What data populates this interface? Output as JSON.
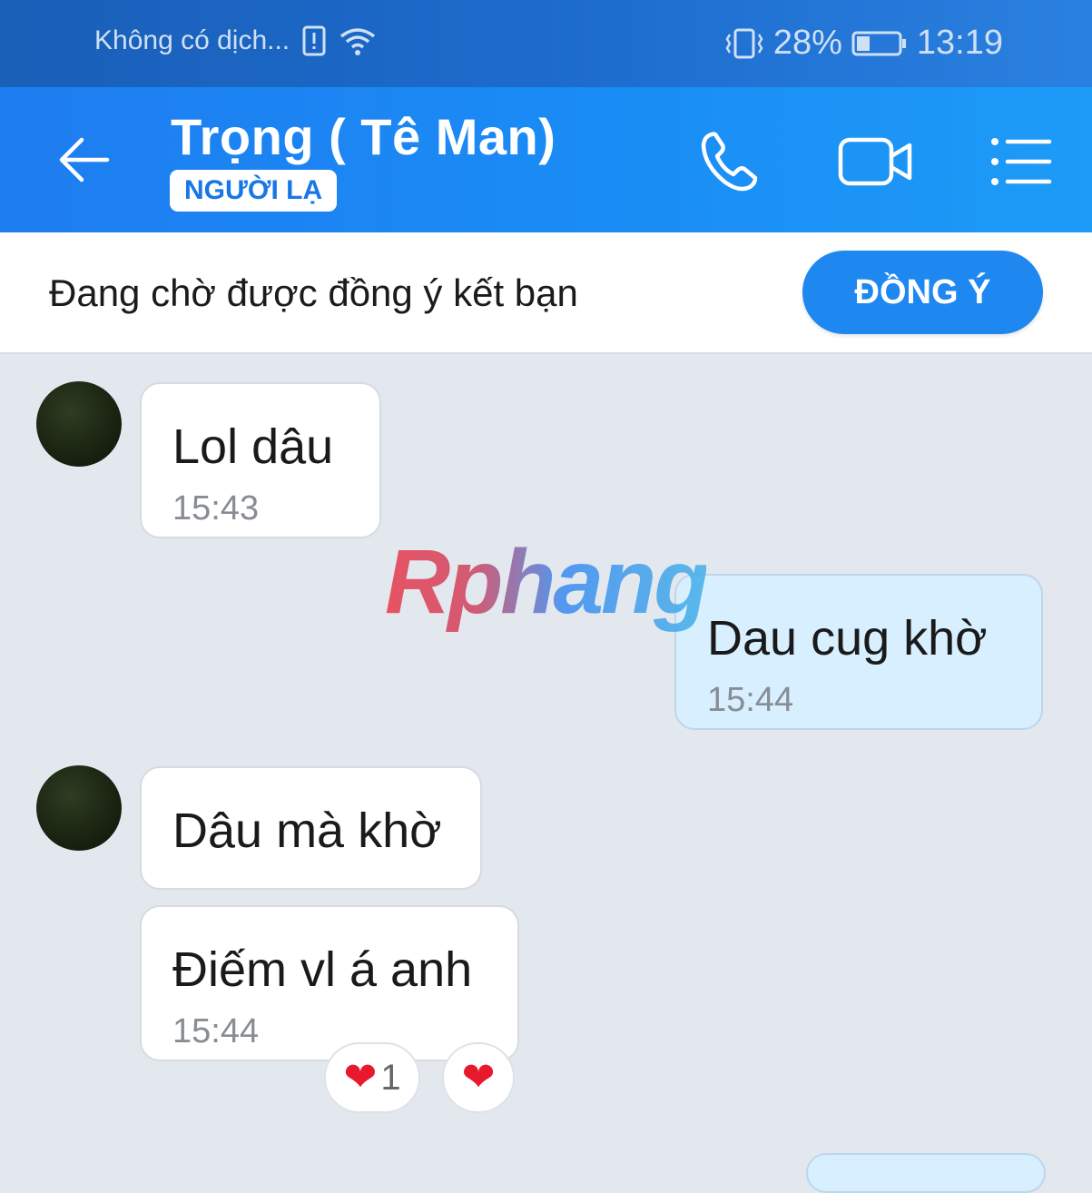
{
  "status_bar": {
    "network_text": "Không có dịch...",
    "battery_percent": "28%",
    "time": "13:19"
  },
  "header": {
    "title": "Trọng ( Tê Man)",
    "badge": "NGƯỜI LẠ"
  },
  "friend_request": {
    "text": "Đang chờ được đồng ý kết bạn",
    "button_label": "ĐỒNG Ý"
  },
  "watermark": "Rphang",
  "messages": [
    {
      "sender": "other",
      "text": "Lol dâu",
      "time": "15:43"
    },
    {
      "sender": "me",
      "text": "Dau cug khờ",
      "time": "15:44"
    },
    {
      "sender": "other",
      "text": "Dâu mà khờ",
      "time": ""
    },
    {
      "sender": "other",
      "text": "Điếm vl á anh",
      "time": "15:44",
      "reaction_count": "1"
    }
  ],
  "colors": {
    "header": "#1e7df0",
    "status_bar": "#1a5fb8",
    "accent_button": "#1e88f0",
    "chat_background": "#e3e8ef",
    "my_bubble": "#d7efff"
  }
}
